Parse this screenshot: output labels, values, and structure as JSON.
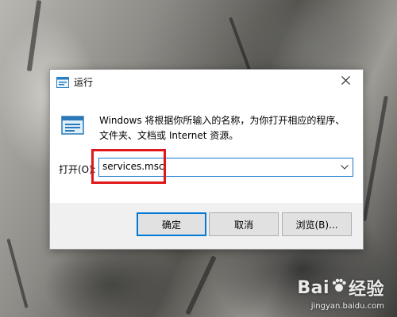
{
  "dialog": {
    "title": "运行",
    "description": "Windows 将根据你所输入的名称，为你打开相应的程序、文件夹、文档或 Internet 资源。",
    "open_label": "打开(O):",
    "input_value": "services.msc",
    "buttons": {
      "ok": "确定",
      "cancel": "取消",
      "browse": "浏览(B)..."
    }
  },
  "watermark": {
    "brand_left": "Bai",
    "brand_right": "经验",
    "url": "jingyan.baidu.com"
  },
  "colors": {
    "highlight": "#e0171b",
    "focus_border": "#0078d7"
  },
  "icons": {
    "title": "run-icon",
    "close": "close-icon",
    "dropdown": "chevron-down-icon"
  }
}
